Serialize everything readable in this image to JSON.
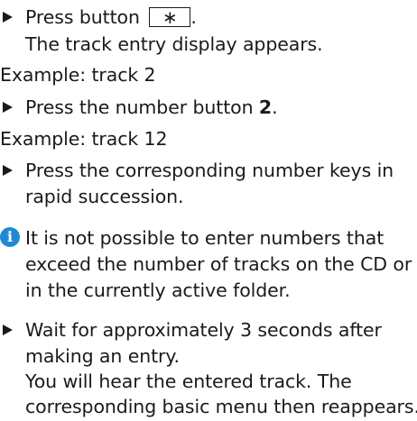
{
  "steps": {
    "s1_prefix": "Press button",
    "s1_key": "∗",
    "s1_suffix": ".",
    "s1_result": "The track entry display appears.",
    "example1": "Example: track 2",
    "s2_prefix": "Press the number button ",
    "s2_key": "2",
    "s2_suffix": ".",
    "example2": "Example: track 12",
    "s3_line1": "Press the corresponding number keys in",
    "s3_line2": "rapid succession.",
    "info_icon": "i",
    "info_line1": "It is not possible to enter numbers that",
    "info_line2": "exceed the number of tracks on the CD or",
    "info_line3": "in the currently active folder.",
    "s4_line1": "Wait for approximately 3 seconds after",
    "s4_line2": "making an entry.",
    "s4_line3": "You will hear the entered track. The",
    "s4_line4": "corresponding basic menu then reappears."
  },
  "colors": {
    "text": "#1a1a1a",
    "info_icon_bg": "#1f8ad3"
  }
}
